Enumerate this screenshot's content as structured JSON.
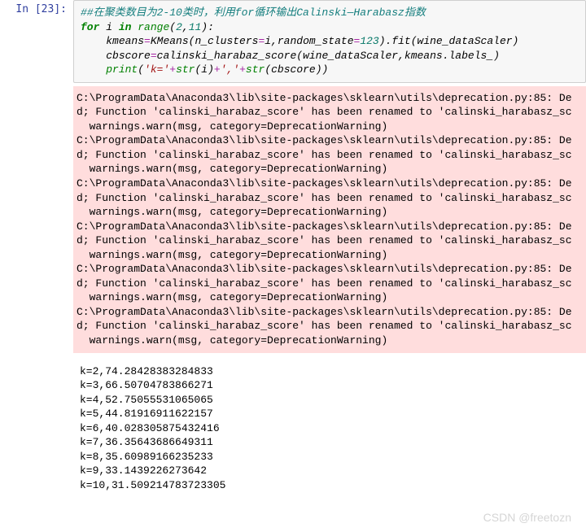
{
  "prompt": "In [23]:",
  "code": {
    "comment": "##在聚类数目为2-10类时，利用for循环输出Calinski—Harabasz指数",
    "for_kw": "for",
    "in_kw": "in",
    "loop_var": " i ",
    "range_call": "range",
    "range_args_open": "(",
    "range_a": "2",
    "range_comma": ",",
    "range_b": "11",
    "range_args_close": "):",
    "indent": "    ",
    "l2_lhs": "kmeans",
    "l2_eq": "=",
    "l2_km": "KMeans(n_clusters",
    "l2_eq2": "=",
    "l2_i": "i,random_state",
    "l2_eq3": "=",
    "l2_num": "123",
    "l2_fit": ").fit(wine_dataScaler)",
    "l3": "cbscore",
    "l3_eq": "=",
    "l3_rest": "calinski_harabaz_score(wine_dataScaler,kmeans.labels_)",
    "l4_print": "print",
    "l4_open": "(",
    "l4_s1": "'k='",
    "l4_plus1": "+",
    "l4_str1": "str",
    "l4_p1": "(i)",
    "l4_plus2": "+",
    "l4_s2": "','",
    "l4_plus3": "+",
    "l4_str2": "str",
    "l4_p2": "(cbscore))"
  },
  "stderr_lines": [
    "C:\\ProgramData\\Anaconda3\\lib\\site-packages\\sklearn\\utils\\deprecation.py:85: De",
    "d; Function 'calinski_harabaz_score' has been renamed to 'calinski_harabasz_sc",
    "  warnings.warn(msg, category=DeprecationWarning)",
    "C:\\ProgramData\\Anaconda3\\lib\\site-packages\\sklearn\\utils\\deprecation.py:85: De",
    "d; Function 'calinski_harabaz_score' has been renamed to 'calinski_harabasz_sc",
    "  warnings.warn(msg, category=DeprecationWarning)",
    "C:\\ProgramData\\Anaconda3\\lib\\site-packages\\sklearn\\utils\\deprecation.py:85: De",
    "d; Function 'calinski_harabaz_score' has been renamed to 'calinski_harabasz_sc",
    "  warnings.warn(msg, category=DeprecationWarning)",
    "C:\\ProgramData\\Anaconda3\\lib\\site-packages\\sklearn\\utils\\deprecation.py:85: De",
    "d; Function 'calinski_harabaz_score' has been renamed to 'calinski_harabasz_sc",
    "  warnings.warn(msg, category=DeprecationWarning)",
    "C:\\ProgramData\\Anaconda3\\lib\\site-packages\\sklearn\\utils\\deprecation.py:85: De",
    "d; Function 'calinski_harabaz_score' has been renamed to 'calinski_harabasz_sc",
    "  warnings.warn(msg, category=DeprecationWarning)",
    "C:\\ProgramData\\Anaconda3\\lib\\site-packages\\sklearn\\utils\\deprecation.py:85: De",
    "d; Function 'calinski_harabaz_score' has been renamed to 'calinski_harabasz_sc",
    "  warnings.warn(msg, category=DeprecationWarning)"
  ],
  "stdout_lines": [
    "k=2,74.28428383284833",
    "k=3,66.50704783866271",
    "k=4,52.75055531065065",
    "k=5,44.81916911622157",
    "k=6,40.028305875432416",
    "k=7,36.35643686649311",
    "k=8,35.60989166235233",
    "k=9,33.1439226273642",
    "k=10,31.509214783723305"
  ],
  "watermark": "CSDN @freetozn"
}
